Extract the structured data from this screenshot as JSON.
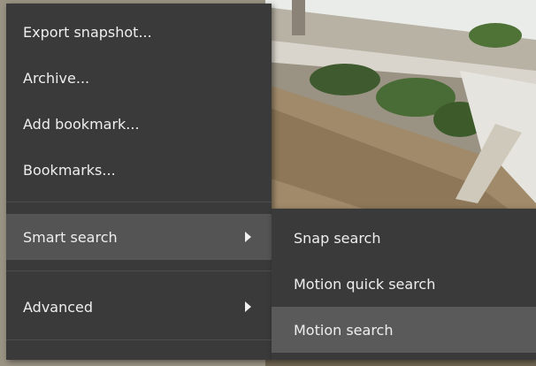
{
  "context_menu": {
    "items": [
      {
        "label": "Export snapshot..."
      },
      {
        "label": "Archive..."
      },
      {
        "label": "Add bookmark..."
      },
      {
        "label": "Bookmarks..."
      },
      {
        "label": "Smart search",
        "has_submenu": true,
        "highlighted": true
      },
      {
        "label": "Advanced",
        "has_submenu": true
      }
    ]
  },
  "smart_search_submenu": {
    "items": [
      {
        "label": "Snap search"
      },
      {
        "label": "Motion quick search"
      },
      {
        "label": "Motion search",
        "highlighted": true
      }
    ]
  },
  "colors": {
    "menu_background": "#3a3a3a",
    "menu_highlight": "#545454",
    "submenu_highlight": "#5a5a5a",
    "menu_text": "#eeeeee",
    "separator": "#4d4d4d"
  },
  "icons": {
    "submenu_arrow": "chevron-right-icon"
  }
}
